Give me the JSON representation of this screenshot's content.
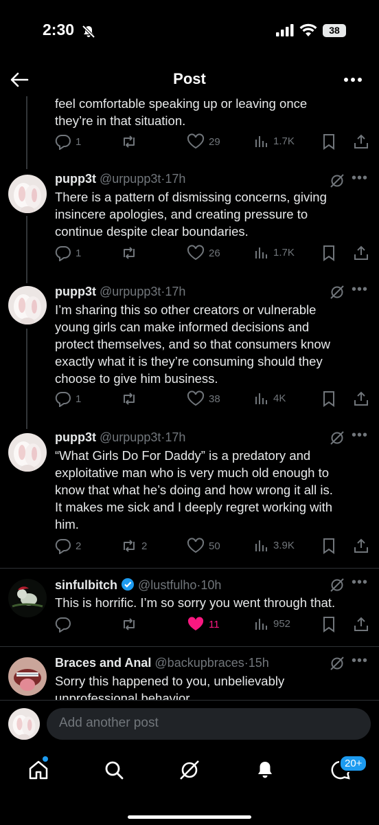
{
  "status": {
    "time": "2:30",
    "battery": "38"
  },
  "header": {
    "title": "Post"
  },
  "posts": [
    {
      "lines": [
        "feel comfortable speaking up or leaving once",
        "they’re in that situation."
      ],
      "replies": "1",
      "reposts": "",
      "likes": "29",
      "views": "1.7K"
    },
    {
      "name": "pupp3t",
      "handle": "@urpupp3t",
      "time": "17h",
      "lines": [
        "There is a pattern of dismissing concerns, giving",
        "insincere apologies, and creating pressure to",
        "continue despite clear boundaries."
      ],
      "replies": "1",
      "reposts": "",
      "likes": "26",
      "views": "1.7K"
    },
    {
      "name": "pupp3t",
      "handle": "@urpupp3t",
      "time": "17h",
      "lines": [
        "I’m sharing this so other creators or vulnerable",
        "young girls can make informed decisions and",
        "protect themselves, and so that consumers know",
        "exactly what it is they’re consuming should they",
        "choose to give him business."
      ],
      "replies": "1",
      "reposts": "",
      "likes": "38",
      "views": "4K"
    },
    {
      "name": "pupp3t",
      "handle": "@urpupp3t",
      "time": "17h",
      "lines": [
        "“What Girls Do For Daddy” is a predatory and",
        "exploitative man who is very much old enough to",
        "know that what he’s doing and how wrong it all is.",
        "It makes me sick and I deeply regret working with",
        "him."
      ],
      "replies": "2",
      "reposts": "2",
      "likes": "50",
      "views": "3.9K"
    },
    {
      "name": "sinfulbitch",
      "handle": "@lustfulho",
      "time": "10h",
      "lines": [
        "This is horrific. I’m so sorry you went through that."
      ],
      "replies": "",
      "reposts": "",
      "likes": "11",
      "views": "952"
    },
    {
      "name": "Braces and Anal",
      "handle": "@backupbraces",
      "time": "15h",
      "lines": [
        "Sorry this happened to you, unbelievably",
        "unprofessional behavior"
      ]
    }
  ],
  "composer": {
    "placeholder": "Add another post"
  },
  "nav": {
    "messages_badge": "20+"
  },
  "colors": {
    "like_active": "#f91880",
    "accent": "#1d9bf0",
    "verified": "#1d9bf0"
  }
}
